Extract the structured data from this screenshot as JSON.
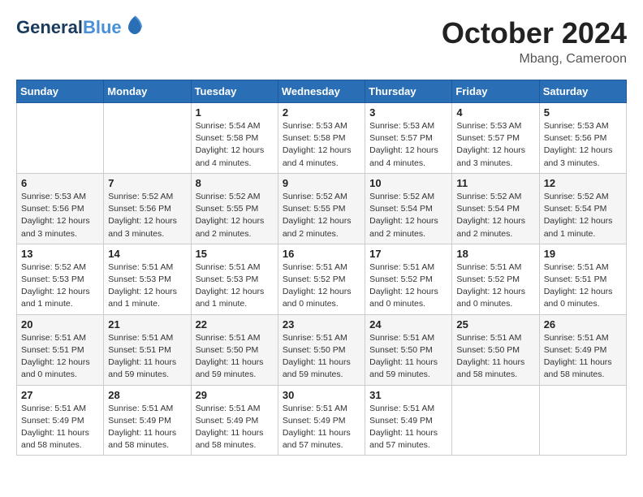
{
  "logo": {
    "line1": "General",
    "line2": "Blue"
  },
  "title": "October 2024",
  "location": "Mbang, Cameroon",
  "weekdays": [
    "Sunday",
    "Monday",
    "Tuesday",
    "Wednesday",
    "Thursday",
    "Friday",
    "Saturday"
  ],
  "weeks": [
    [
      {
        "day": "",
        "info": ""
      },
      {
        "day": "",
        "info": ""
      },
      {
        "day": "1",
        "info": "Sunrise: 5:54 AM\nSunset: 5:58 PM\nDaylight: 12 hours\nand 4 minutes."
      },
      {
        "day": "2",
        "info": "Sunrise: 5:53 AM\nSunset: 5:58 PM\nDaylight: 12 hours\nand 4 minutes."
      },
      {
        "day": "3",
        "info": "Sunrise: 5:53 AM\nSunset: 5:57 PM\nDaylight: 12 hours\nand 4 minutes."
      },
      {
        "day": "4",
        "info": "Sunrise: 5:53 AM\nSunset: 5:57 PM\nDaylight: 12 hours\nand 3 minutes."
      },
      {
        "day": "5",
        "info": "Sunrise: 5:53 AM\nSunset: 5:56 PM\nDaylight: 12 hours\nand 3 minutes."
      }
    ],
    [
      {
        "day": "6",
        "info": "Sunrise: 5:53 AM\nSunset: 5:56 PM\nDaylight: 12 hours\nand 3 minutes."
      },
      {
        "day": "7",
        "info": "Sunrise: 5:52 AM\nSunset: 5:56 PM\nDaylight: 12 hours\nand 3 minutes."
      },
      {
        "day": "8",
        "info": "Sunrise: 5:52 AM\nSunset: 5:55 PM\nDaylight: 12 hours\nand 2 minutes."
      },
      {
        "day": "9",
        "info": "Sunrise: 5:52 AM\nSunset: 5:55 PM\nDaylight: 12 hours\nand 2 minutes."
      },
      {
        "day": "10",
        "info": "Sunrise: 5:52 AM\nSunset: 5:54 PM\nDaylight: 12 hours\nand 2 minutes."
      },
      {
        "day": "11",
        "info": "Sunrise: 5:52 AM\nSunset: 5:54 PM\nDaylight: 12 hours\nand 2 minutes."
      },
      {
        "day": "12",
        "info": "Sunrise: 5:52 AM\nSunset: 5:54 PM\nDaylight: 12 hours\nand 1 minute."
      }
    ],
    [
      {
        "day": "13",
        "info": "Sunrise: 5:52 AM\nSunset: 5:53 PM\nDaylight: 12 hours\nand 1 minute."
      },
      {
        "day": "14",
        "info": "Sunrise: 5:51 AM\nSunset: 5:53 PM\nDaylight: 12 hours\nand 1 minute."
      },
      {
        "day": "15",
        "info": "Sunrise: 5:51 AM\nSunset: 5:53 PM\nDaylight: 12 hours\nand 1 minute."
      },
      {
        "day": "16",
        "info": "Sunrise: 5:51 AM\nSunset: 5:52 PM\nDaylight: 12 hours\nand 0 minutes."
      },
      {
        "day": "17",
        "info": "Sunrise: 5:51 AM\nSunset: 5:52 PM\nDaylight: 12 hours\nand 0 minutes."
      },
      {
        "day": "18",
        "info": "Sunrise: 5:51 AM\nSunset: 5:52 PM\nDaylight: 12 hours\nand 0 minutes."
      },
      {
        "day": "19",
        "info": "Sunrise: 5:51 AM\nSunset: 5:51 PM\nDaylight: 12 hours\nand 0 minutes."
      }
    ],
    [
      {
        "day": "20",
        "info": "Sunrise: 5:51 AM\nSunset: 5:51 PM\nDaylight: 12 hours\nand 0 minutes."
      },
      {
        "day": "21",
        "info": "Sunrise: 5:51 AM\nSunset: 5:51 PM\nDaylight: 11 hours\nand 59 minutes."
      },
      {
        "day": "22",
        "info": "Sunrise: 5:51 AM\nSunset: 5:50 PM\nDaylight: 11 hours\nand 59 minutes."
      },
      {
        "day": "23",
        "info": "Sunrise: 5:51 AM\nSunset: 5:50 PM\nDaylight: 11 hours\nand 59 minutes."
      },
      {
        "day": "24",
        "info": "Sunrise: 5:51 AM\nSunset: 5:50 PM\nDaylight: 11 hours\nand 59 minutes."
      },
      {
        "day": "25",
        "info": "Sunrise: 5:51 AM\nSunset: 5:50 PM\nDaylight: 11 hours\nand 58 minutes."
      },
      {
        "day": "26",
        "info": "Sunrise: 5:51 AM\nSunset: 5:49 PM\nDaylight: 11 hours\nand 58 minutes."
      }
    ],
    [
      {
        "day": "27",
        "info": "Sunrise: 5:51 AM\nSunset: 5:49 PM\nDaylight: 11 hours\nand 58 minutes."
      },
      {
        "day": "28",
        "info": "Sunrise: 5:51 AM\nSunset: 5:49 PM\nDaylight: 11 hours\nand 58 minutes."
      },
      {
        "day": "29",
        "info": "Sunrise: 5:51 AM\nSunset: 5:49 PM\nDaylight: 11 hours\nand 58 minutes."
      },
      {
        "day": "30",
        "info": "Sunrise: 5:51 AM\nSunset: 5:49 PM\nDaylight: 11 hours\nand 57 minutes."
      },
      {
        "day": "31",
        "info": "Sunrise: 5:51 AM\nSunset: 5:49 PM\nDaylight: 11 hours\nand 57 minutes."
      },
      {
        "day": "",
        "info": ""
      },
      {
        "day": "",
        "info": ""
      }
    ]
  ]
}
